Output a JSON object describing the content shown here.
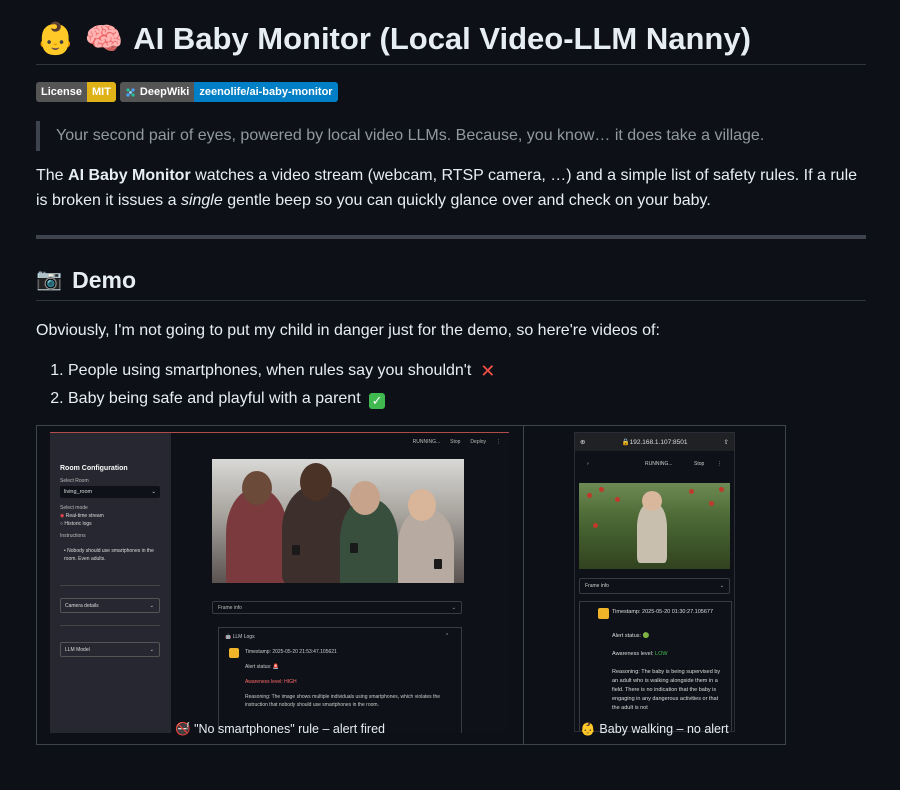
{
  "header": {
    "emoji_baby": "👶",
    "emoji_brain": "🧠",
    "title": "AI Baby Monitor (Local Video-LLM Nanny)"
  },
  "badges": [
    {
      "left": "License",
      "right": "MIT",
      "right_color": "#dfb317"
    },
    {
      "left": "DeepWiki",
      "right": "zeenolife/ai-baby-monitor",
      "right_color": "#007ec6"
    }
  ],
  "quote": "Your second pair of eyes, powered by local video LLMs. Because, you know… it does take a village.",
  "intro": {
    "p1": "The ",
    "bold": "AI Baby Monitor",
    "p2": " watches a video stream (webcam, RTSP camera, …) and a simple list of safety rules. If a rule is broken it issues a ",
    "italic": "single",
    "p3": " gentle beep so you can quickly glance over and check on your baby."
  },
  "demo": {
    "emoji": "📷",
    "heading": "Demo",
    "lead": "Obviously, I'm not going to put my child in danger just for the demo, so here're videos of:",
    "items": [
      "People using smartphones, when rules say you shouldn't",
      "Baby being safe and playful with a parent"
    ],
    "captions": {
      "left_emoji": "🚭",
      "left": "\"No smartphones\" rule – alert fired",
      "right_emoji": "👶",
      "right": "Baby walking – no alert"
    }
  },
  "shot_left": {
    "topbar": [
      "RUNNING...",
      "Stop",
      "Deploy",
      "⋮"
    ],
    "sidebar_title": "Room Configuration",
    "select_room_label": "Select Room",
    "room_value": "living_room",
    "source_label": "Select mode",
    "radio1": "Real-time stream",
    "radio2": "Historic logs",
    "rules_label": "Instructions",
    "rule": "Nobody should use smartphones in the room. Even adults.",
    "camera_details": "Camera details",
    "llm_model": "LLM Model",
    "frame_info": "Frame info",
    "log_header": "LLM Logs",
    "timestamp": "Timestamp: 2025-05-20 21:53:47.105621",
    "alert": "Alert status: 🚨",
    "awareness": "Awareness level: HIGH",
    "reasoning": "Reasoning: The image shows multiple individuals using smartphones, which violates the instruction that nobody should use smartphones in the room."
  },
  "shot_right": {
    "url": "192.168.1.107:8501",
    "running": "RUNNING...",
    "stop": "Stop",
    "frame_info": "Frame info",
    "timestamp": "Timestamp: 2025-05-20 01:30:27.105677",
    "alert": "Alert status: 🟢",
    "awareness_prefix": "Awareness level: ",
    "awareness_value": "LOW",
    "reasoning": "Reasoning: The baby is being supervised by an adult who is walking alongside them in a field. There is no indication that the baby is engaging in any dangerous activities or that the adult is not"
  },
  "colors": {
    "background": "#0d1117",
    "text": "#e6edf3",
    "muted": "#9198a1",
    "border": "#3d444d"
  }
}
